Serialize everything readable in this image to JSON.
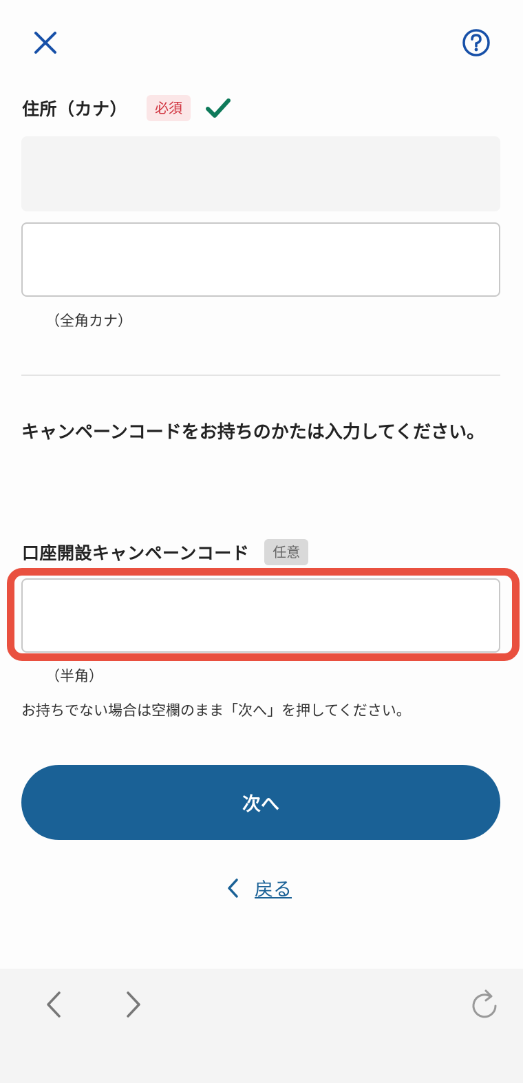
{
  "header": {
    "close_icon": "close-icon",
    "help_icon": "help-icon"
  },
  "address_kana": {
    "label": "住所（カナ）",
    "badge": "必須",
    "check_icon": "check-icon",
    "readonly_value": "",
    "input_value": "",
    "hint": "（全角カナ）"
  },
  "campaign": {
    "intro": "キャンペーンコードをお持ちのかたは入力してください。",
    "label": "口座開設キャンペーンコード",
    "badge": "任意",
    "input_value": "",
    "hint": "（半角）",
    "note": "お持ちでない場合は空欄のまま「次へ」を押してください。"
  },
  "actions": {
    "next_label": "次へ",
    "back_label": "戻る"
  },
  "browser_bar": {
    "back_icon": "chevron-left-icon",
    "forward_icon": "chevron-right-icon",
    "reload_icon": "reload-icon"
  },
  "colors": {
    "accent": "#1a6196",
    "close_icon": "#1750a8",
    "required_badge_text": "#d0313d",
    "check": "#0e7a5a",
    "highlight": "#e9503f"
  }
}
